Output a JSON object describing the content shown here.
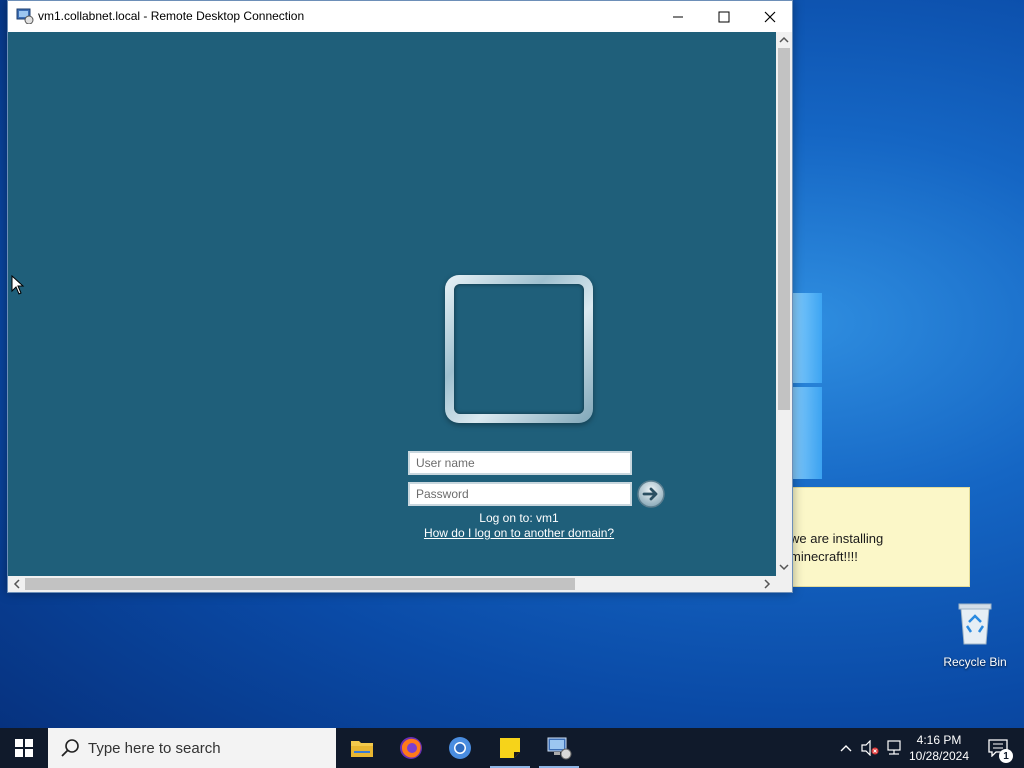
{
  "window": {
    "title": "vm1.collabnet.local - Remote Desktop Connection"
  },
  "login": {
    "username_placeholder": "User name",
    "password_placeholder": "Password",
    "logon_to": "Log on to: vm1",
    "domain_link": "How do I log on to another domain?"
  },
  "desktop": {
    "sticky_note_text": "we are installing\nminecraft!!!!",
    "recycle_bin_label": "Recycle Bin"
  },
  "taskbar": {
    "search_placeholder": "Type here to search",
    "apps": [
      {
        "name": "file-explorer-icon"
      },
      {
        "name": "firefox-icon"
      },
      {
        "name": "chromium-icon"
      },
      {
        "name": "sticky-notes-icon"
      },
      {
        "name": "remote-desktop-icon"
      }
    ],
    "clock_time": "4:16 PM",
    "clock_date": "10/28/2024",
    "notification_count": "1"
  },
  "colors": {
    "remote_background": "#1f5f7a",
    "taskbar": "#101a2b",
    "sticky_note": "#fbf7c8"
  }
}
